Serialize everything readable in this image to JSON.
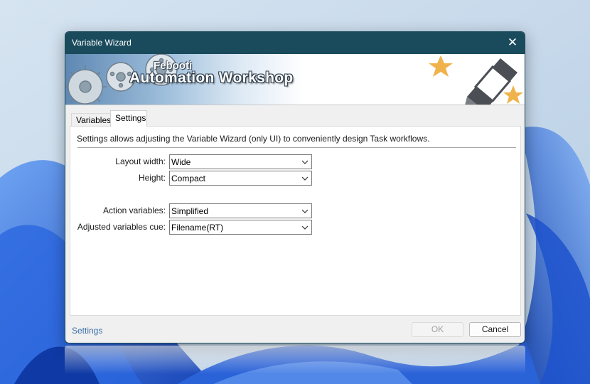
{
  "window": {
    "title": "Variable Wizard",
    "close_glyph": "✕"
  },
  "banner": {
    "brand_small": "Febooti",
    "brand_big": "Automation Workshop"
  },
  "tabs": [
    {
      "label": "Variables",
      "selected": false
    },
    {
      "label": "Settings",
      "selected": true
    }
  ],
  "settings": {
    "description": "Settings allows adjusting the Variable Wizard (only UI) to conveniently design Task workflows.",
    "fields": [
      {
        "label": "Layout width:",
        "value": "Wide"
      },
      {
        "label": "Height:",
        "value": "Compact"
      },
      {
        "label": "Action variables:",
        "value": "Simplified"
      },
      {
        "label": "Adjusted variables cue:",
        "value": "Filename(RT)"
      }
    ]
  },
  "footer": {
    "help_link": "Settings",
    "ok_label": "OK",
    "ok_enabled": false,
    "cancel_label": "Cancel"
  },
  "icons": {
    "close": "close-icon",
    "dropdown": "chevron-down-icon",
    "gears": "gear-icon",
    "pen": "pen-icon",
    "stars": "star-icon"
  },
  "colors": {
    "titlebar": "#1a4b5d",
    "link": "#3b6ea8",
    "star": "#f0b24a",
    "desktop_accent": "#1f5fd6"
  }
}
